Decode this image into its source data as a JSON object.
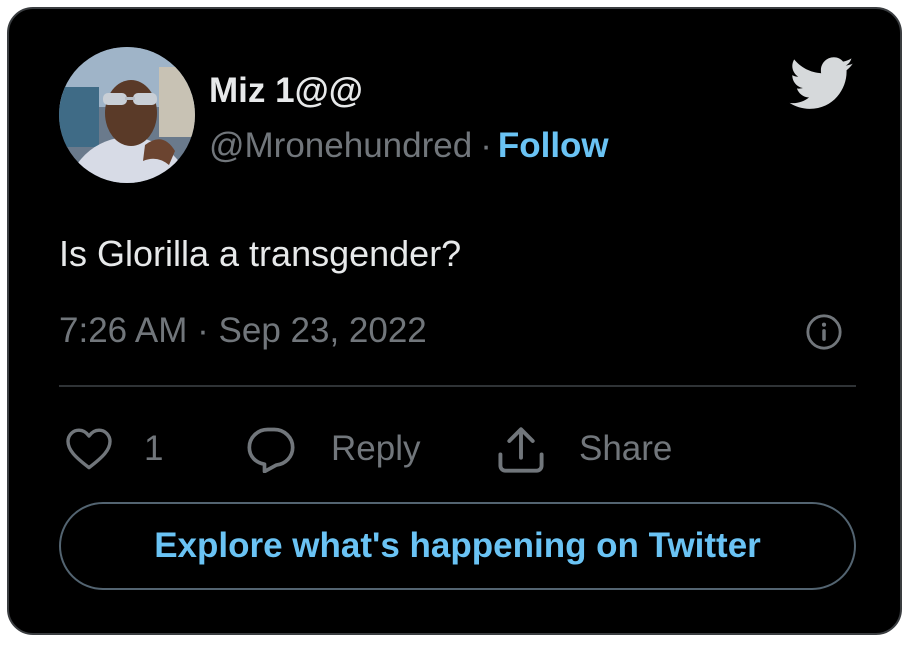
{
  "author": {
    "display_name": "Miz 1@@",
    "handle": "@Mronehundred",
    "separator": "·",
    "follow_label": "Follow"
  },
  "tweet": {
    "text": "Is Glorilla a transgender?",
    "timestamp": "7:26 AM · Sep 23, 2022"
  },
  "actions": {
    "like_count": "1",
    "reply_label": "Reply",
    "share_label": "Share"
  },
  "explore_label": "Explore what's happening on Twitter",
  "icons": {
    "brand": "twitter-bird-icon",
    "info": "info-icon",
    "like": "heart-icon",
    "reply": "speech-bubble-icon",
    "share": "share-upload-icon"
  },
  "colors": {
    "background": "#000000",
    "text_primary": "#e7e9ea",
    "text_secondary": "#71767b",
    "link": "#6ac3f4",
    "border": "#3a3d40"
  }
}
